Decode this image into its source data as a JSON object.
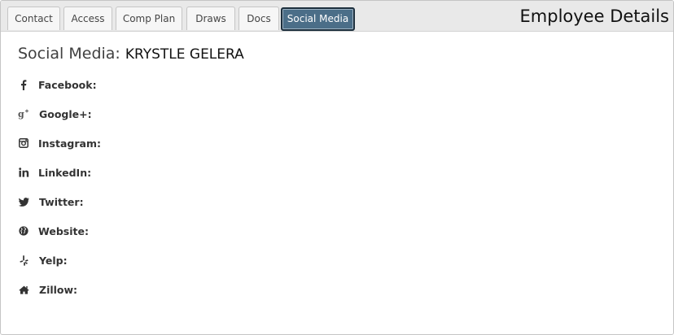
{
  "tabs": [
    {
      "label": "Contact",
      "active": false
    },
    {
      "label": "Access",
      "active": false
    },
    {
      "label": "Comp Plan",
      "active": false
    },
    {
      "label": "Draws",
      "active": false
    },
    {
      "label": "Docs",
      "active": false
    },
    {
      "label": "Social Media",
      "active": true
    }
  ],
  "header": {
    "title": "Employee Details"
  },
  "section": {
    "label": "Social Media:",
    "employee_name": "KRYSTLE GELERA"
  },
  "social": [
    {
      "icon": "facebook-icon",
      "label": "Facebook:"
    },
    {
      "icon": "google-plus-icon",
      "label": "Google+:"
    },
    {
      "icon": "instagram-icon",
      "label": "Instagram:"
    },
    {
      "icon": "linkedin-icon",
      "label": "LinkedIn:"
    },
    {
      "icon": "twitter-icon",
      "label": "Twitter:"
    },
    {
      "icon": "globe-icon",
      "label": "Website:"
    },
    {
      "icon": "yelp-icon",
      "label": "Yelp:"
    },
    {
      "icon": "home-icon",
      "label": "Zillow:"
    }
  ],
  "colors": {
    "active_tab_bg": "#4b6e88",
    "tabbar_bg": "#e9e9e9",
    "text": "#333333"
  }
}
